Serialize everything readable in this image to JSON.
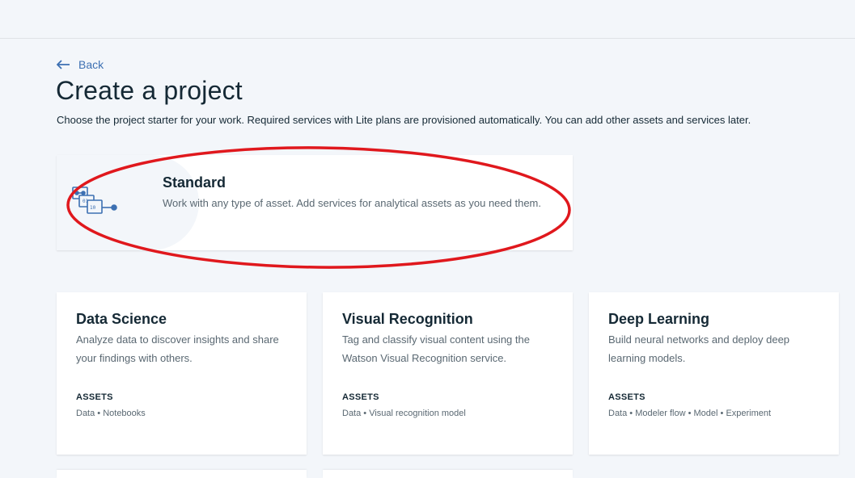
{
  "header": {
    "back_label": "Back",
    "title": "Create a project",
    "subtitle": "Choose the project starter for your work. Required services with Lite plans are provisioned automatically. You can add other assets and services later."
  },
  "standard": {
    "title": "Standard",
    "description": "Work with any type of asset. Add services for analytical assets as you need them.",
    "icon": "project-flow-icon"
  },
  "starters": [
    {
      "title": "Data Science",
      "description": "Analyze data to discover insights and share your findings with others.",
      "assets_label": "ASSETS",
      "assets": "Data • Notebooks"
    },
    {
      "title": "Visual Recognition",
      "description": "Tag and classify visual content using the Watson Visual Recognition service.",
      "assets_label": "ASSETS",
      "assets": "Data • Visual recognition model"
    },
    {
      "title": "Deep Learning",
      "description": "Build neural networks and deploy deep learning models.",
      "assets_label": "ASSETS",
      "assets": "Data • Modeler flow • Model • Experiment"
    }
  ],
  "colors": {
    "background": "#f3f6fa",
    "link": "#3d70b2",
    "text": "#152935",
    "muted": "#5a6872",
    "annotation": "#e0181d"
  }
}
